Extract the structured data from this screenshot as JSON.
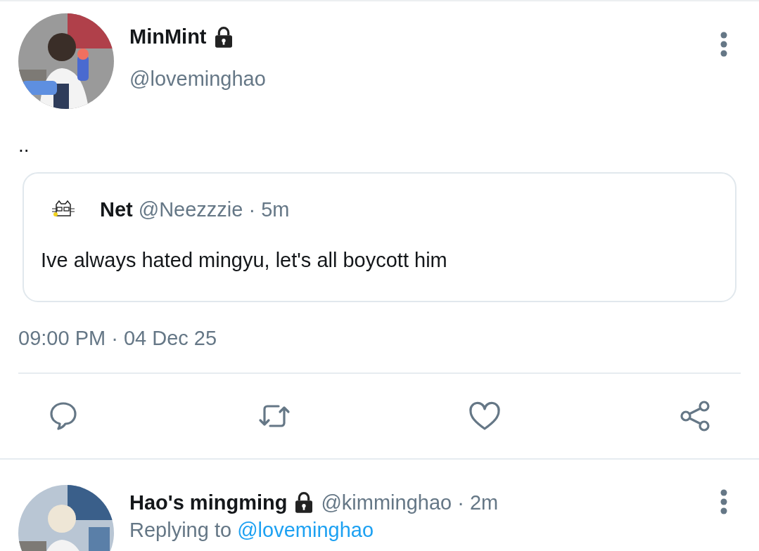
{
  "tweet": {
    "name": "MinMint",
    "locked": true,
    "handle": "@loveminghao",
    "text": "..",
    "quote": {
      "name": "Net",
      "meta": "@Neezzzie · 5m",
      "text": "Ive always hated mingyu, let's all boycott him"
    },
    "timestamp": "09:00 PM · 04 Dec 25",
    "actions": [
      {
        "kind": "reply"
      },
      {
        "kind": "retweet"
      },
      {
        "kind": "like"
      },
      {
        "kind": "share"
      }
    ]
  },
  "reply": {
    "name": "Hao's mingming",
    "locked": true,
    "meta": "@kimminghao · 2m",
    "replying_label": "Replying to",
    "replying_to": "@loveminghao"
  }
}
